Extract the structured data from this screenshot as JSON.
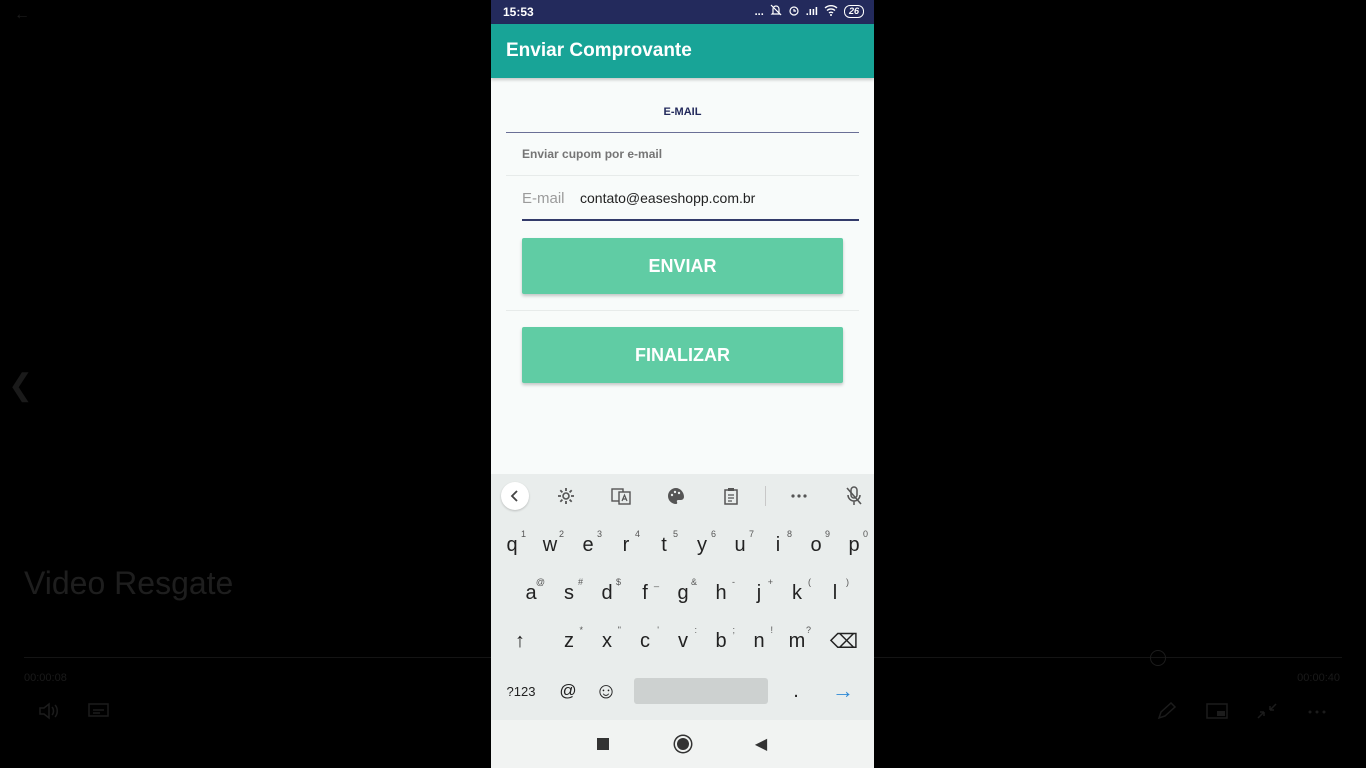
{
  "player": {
    "back_glyph": "←",
    "prev_glyph": "❮",
    "video_title": "Video Resgate",
    "current_time": "00:00:08",
    "total_time": "00:00:40"
  },
  "status_bar": {
    "time": "15:53",
    "dots": "...",
    "signal": ".ııl",
    "battery": "26"
  },
  "app_bar": {
    "title": "Enviar Comprovante"
  },
  "tabs": {
    "email_tab": "E-MAIL"
  },
  "form": {
    "section_label": "Enviar cupom por e-mail",
    "email_label": "E-mail",
    "email_value": "contato@easeshopp.com.br",
    "send_button": "ENVIAR",
    "finish_button": "FINALIZAR"
  },
  "keyboard": {
    "toolbar_icons": [
      "chevron-left-icon",
      "settings-icon",
      "translate-icon",
      "palette-icon",
      "clipboard-icon",
      "more-icon",
      "mic-off-icon"
    ],
    "row1": [
      {
        "key": "q",
        "hint": "1"
      },
      {
        "key": "w",
        "hint": "2"
      },
      {
        "key": "e",
        "hint": "3"
      },
      {
        "key": "r",
        "hint": "4"
      },
      {
        "key": "t",
        "hint": "5"
      },
      {
        "key": "y",
        "hint": "6"
      },
      {
        "key": "u",
        "hint": "7"
      },
      {
        "key": "i",
        "hint": "8"
      },
      {
        "key": "o",
        "hint": "9"
      },
      {
        "key": "p",
        "hint": "0"
      }
    ],
    "row2": [
      {
        "key": "a",
        "hint": "@"
      },
      {
        "key": "s",
        "hint": "#"
      },
      {
        "key": "d",
        "hint": "$"
      },
      {
        "key": "f",
        "hint": "_"
      },
      {
        "key": "g",
        "hint": "&"
      },
      {
        "key": "h",
        "hint": "-"
      },
      {
        "key": "j",
        "hint": "+"
      },
      {
        "key": "k",
        "hint": "("
      },
      {
        "key": "l",
        "hint": ")"
      }
    ],
    "row3": [
      {
        "key": "z",
        "hint": "*"
      },
      {
        "key": "x",
        "hint": "\""
      },
      {
        "key": "c",
        "hint": "'"
      },
      {
        "key": "v",
        "hint": ":"
      },
      {
        "key": "b",
        "hint": ";"
      },
      {
        "key": "n",
        "hint": "!"
      },
      {
        "key": "m",
        "hint": "?"
      }
    ],
    "shift": "↑",
    "backspace": "⌫",
    "symbols": "?123",
    "at": "@",
    "emoji": "☺",
    "period": ".",
    "go": "→"
  },
  "nav_bar": {
    "back_glyph": "◀"
  }
}
